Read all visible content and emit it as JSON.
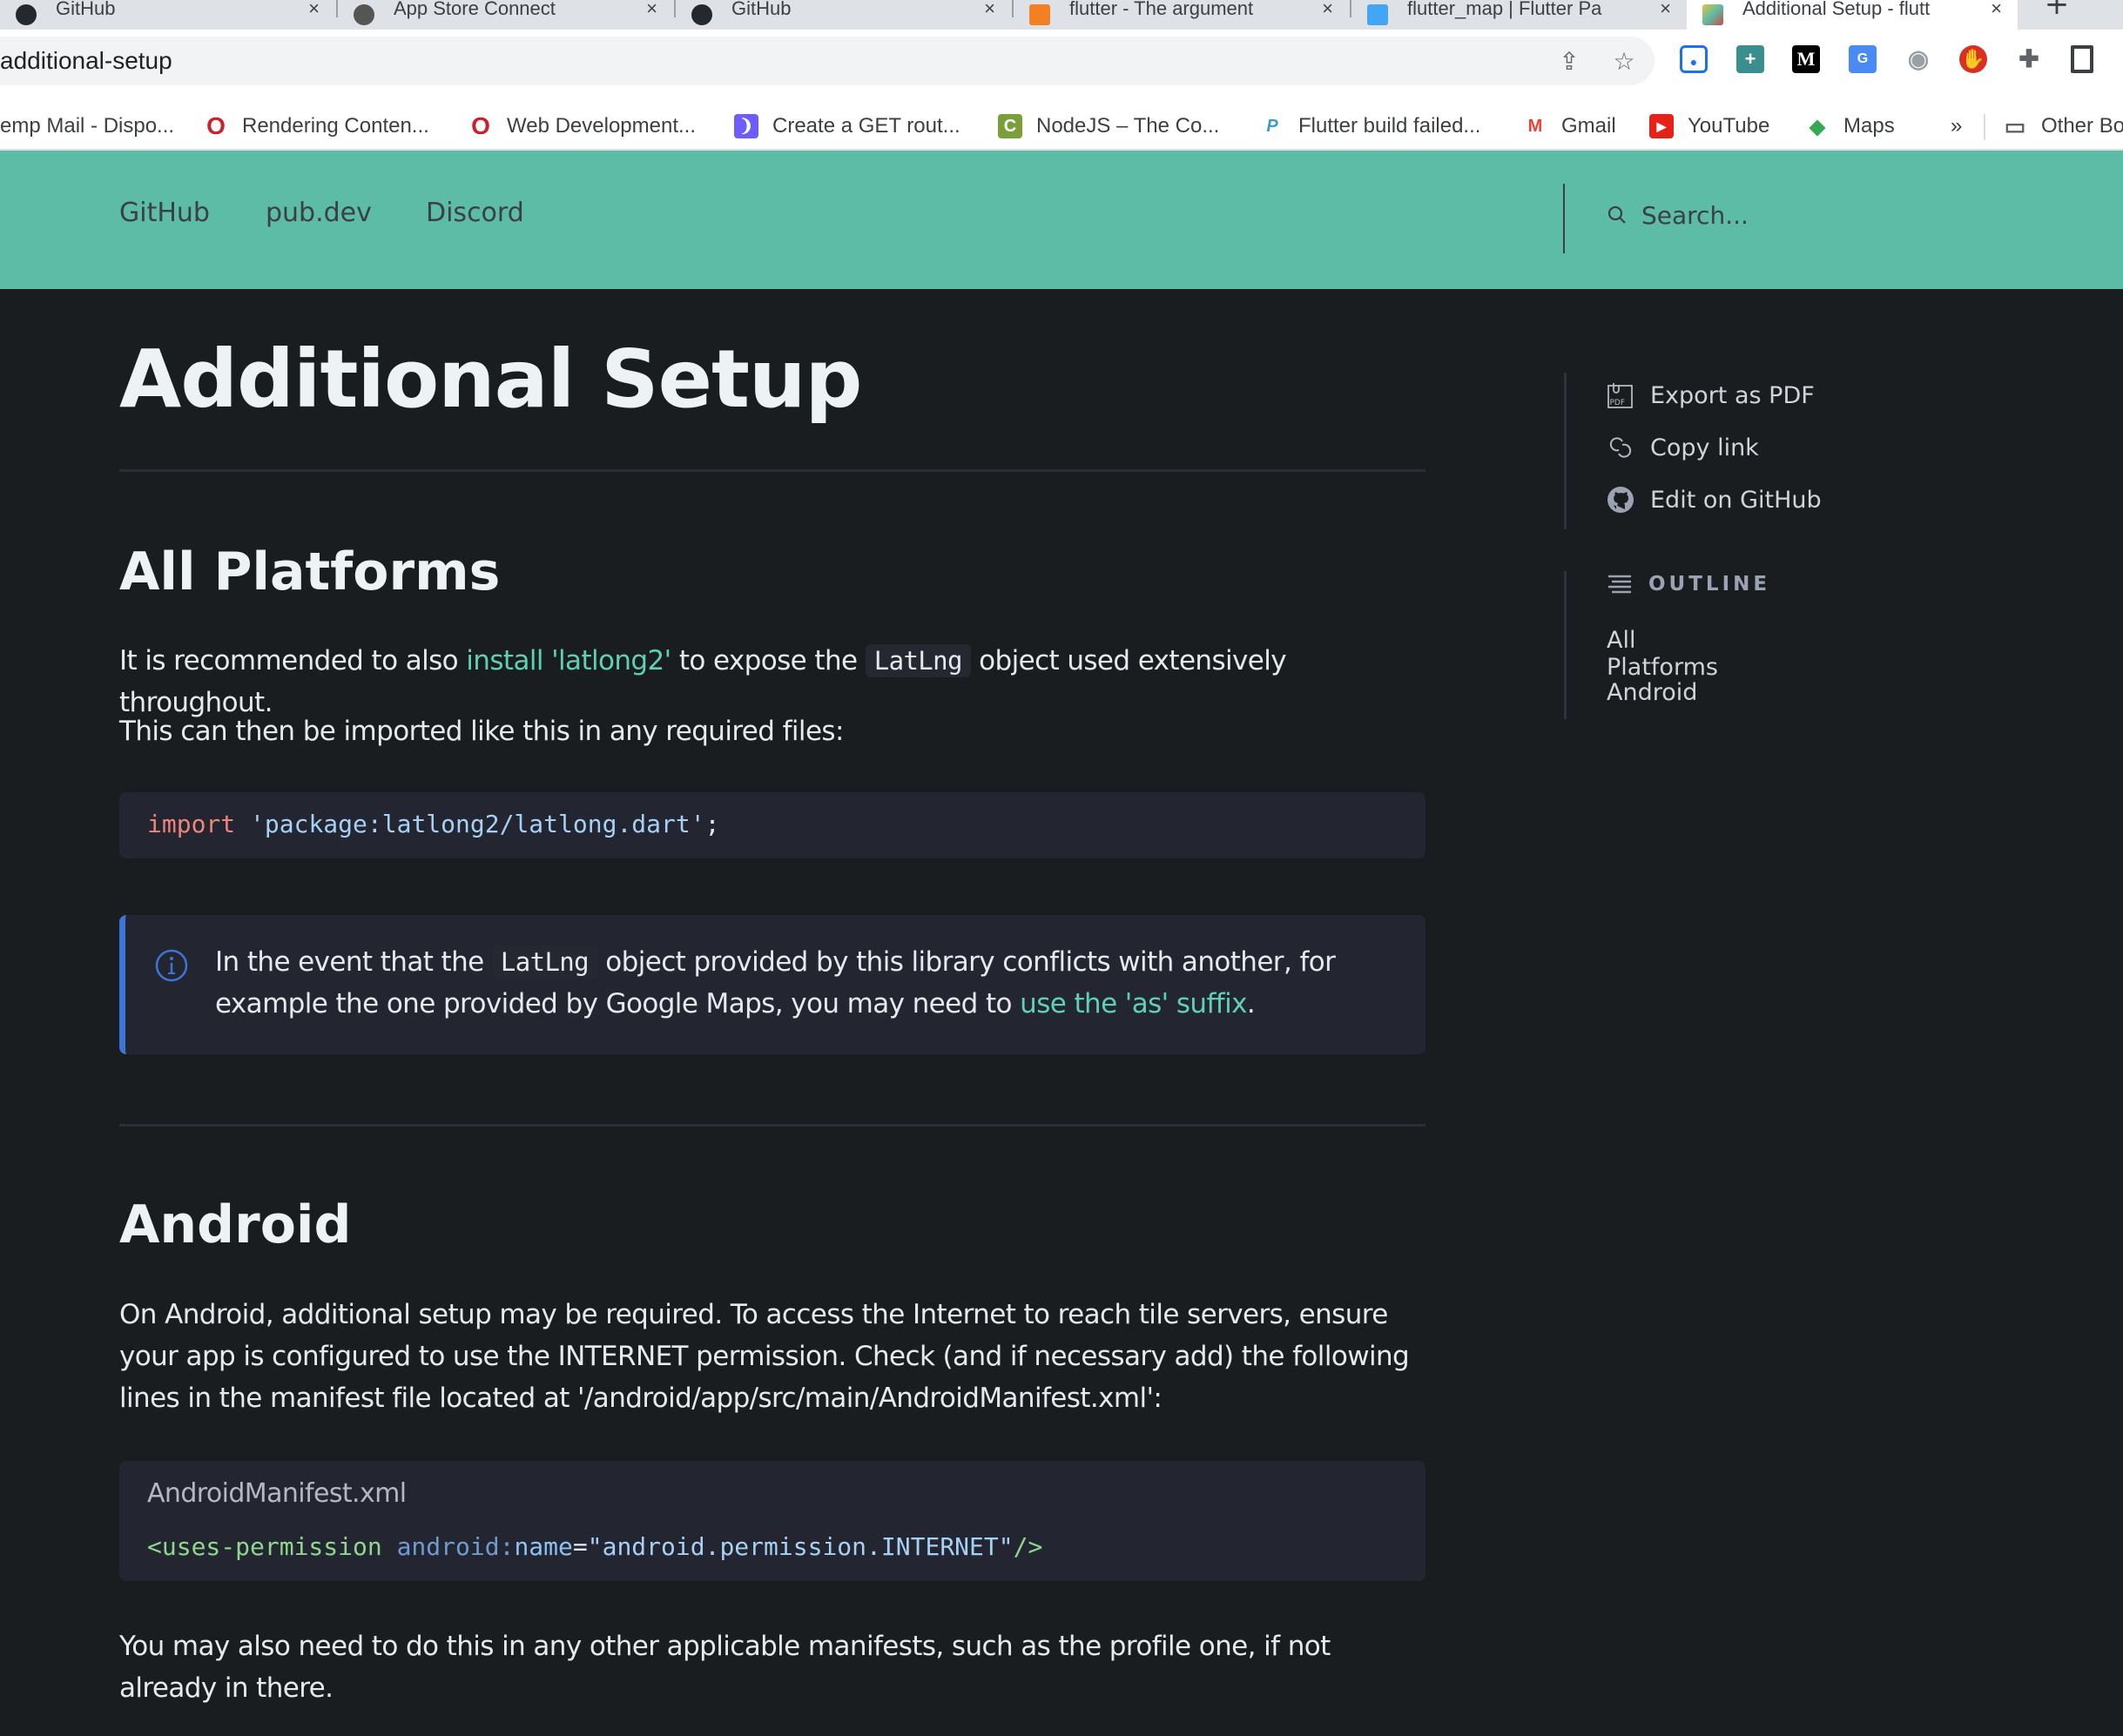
{
  "browser": {
    "tabs": [
      {
        "title": "GitHub",
        "icon": "github-icon",
        "active": false
      },
      {
        "title": "App Store Connect",
        "icon": "apple-icon",
        "active": false
      },
      {
        "title": "GitHub",
        "icon": "github-icon",
        "active": false
      },
      {
        "title": "flutter - The argument",
        "icon": "stackoverflow-icon",
        "active": false
      },
      {
        "title": "flutter_map | Flutter Pa",
        "icon": "flutter-icon",
        "active": false
      },
      {
        "title": "Additional Setup - flutt",
        "icon": "flutter-map-icon",
        "active": true
      }
    ],
    "close_glyph": "×",
    "new_tab_glyph": "+",
    "url": "additional-setup",
    "extensions": [
      "screen-capture-icon",
      "plus-extension-icon",
      "medium-icon",
      "google-translate-icon",
      "camera-icon",
      "adblock-icon",
      "puzzle-extensions-icon",
      "side-panel-icon"
    ],
    "bookmarks": [
      {
        "label": "emp Mail - Dispo...",
        "icon": "none"
      },
      {
        "label": "Rendering Conten...",
        "icon": "opera-icon"
      },
      {
        "label": "Web Development...",
        "icon": "opera-icon"
      },
      {
        "label": "Create a GET rout...",
        "icon": "docs-icon"
      },
      {
        "label": "NodeJS – The Co...",
        "icon": "nodejs-icon"
      },
      {
        "label": "Flutter build failed...",
        "icon": "pub-icon"
      },
      {
        "label": "Gmail",
        "icon": "gmail-icon"
      },
      {
        "label": "YouTube",
        "icon": "youtube-icon"
      },
      {
        "label": "Maps",
        "icon": "maps-icon"
      }
    ],
    "bookmarks_overflow": "»",
    "other_bookmarks": "Other Bo"
  },
  "header": {
    "nav": [
      "GitHub",
      "pub.dev",
      "Discord"
    ],
    "search_placeholder": "Search...",
    "bg_color": "#5cbca6"
  },
  "page": {
    "title": "Additional Setup",
    "sections": {
      "all_platforms": {
        "heading": "All Platforms",
        "p1_before": "It is recommended to also ",
        "p1_link": "install 'latlong2'",
        "p1_mid": " to expose the ",
        "p1_code": "LatLng",
        "p1_after": " object used extensively throughout.",
        "p2": "This can then be imported like this in any required files:",
        "code_keyword": "import",
        "code_string": "'package:latlong2/latlong.dart'",
        "code_semicolon": ";",
        "callout_before": "In the event that the ",
        "callout_code": "LatLng",
        "callout_mid": " object provided by this library conflicts with another, for example the one provided by Google Maps, you may need to ",
        "callout_link": "use the 'as' suffix",
        "callout_after": "."
      },
      "android": {
        "heading": "Android",
        "p1": "On Android, additional setup may be required. To access the Internet to reach tile servers, ensure your app is configured to use the INTERNET permission. Check (and if necessary add) the following lines in the manifest file located at '/android/app/src/main/AndroidManifest.xml':",
        "code_filename": "AndroidManifest.xml",
        "code_tag_open": "<uses-permission",
        "code_attr_ns": "android:",
        "code_attr_name": "name",
        "code_eq": "=",
        "code_value": "\"android.permission.INTERNET\"",
        "code_tag_close": "/>",
        "p2": "You may also need to do this in any other applicable manifests, such as the profile one, if not already in there."
      }
    }
  },
  "sidebar": {
    "actions": [
      {
        "label": "Export as PDF",
        "icon": "pdf-icon"
      },
      {
        "label": "Copy link",
        "icon": "link-icon"
      },
      {
        "label": "Edit on GitHub",
        "icon": "github-icon"
      }
    ],
    "outline_title": "OUTLINE",
    "outline": [
      "All Platforms",
      "Android"
    ]
  },
  "colors": {
    "accent_link": "#5fd0b4",
    "callout_border": "#3e74d8",
    "page_bg": "#1a1d20"
  }
}
